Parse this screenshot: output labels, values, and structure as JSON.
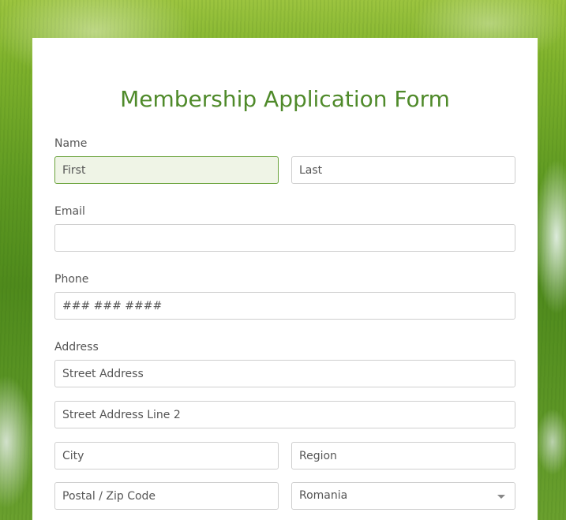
{
  "form": {
    "title": "Membership Application Form",
    "name": {
      "label": "Name",
      "first_placeholder": "First",
      "last_placeholder": "Last"
    },
    "email": {
      "label": "Email",
      "value": ""
    },
    "phone": {
      "label": "Phone",
      "placeholder": "### ### ####"
    },
    "address": {
      "label": "Address",
      "street_placeholder": "Street Address",
      "street2_placeholder": "Street Address Line 2",
      "city_placeholder": "City",
      "region_placeholder": "Region",
      "postal_placeholder": "Postal / Zip Code",
      "country_selected": "Romania"
    }
  },
  "colors": {
    "title": "#4f8a2a",
    "focused_field_background": "#eff4e6",
    "focused_field_border": "#6aa33b"
  },
  "icons": {
    "country_dropdown": "chevron-down-icon"
  }
}
